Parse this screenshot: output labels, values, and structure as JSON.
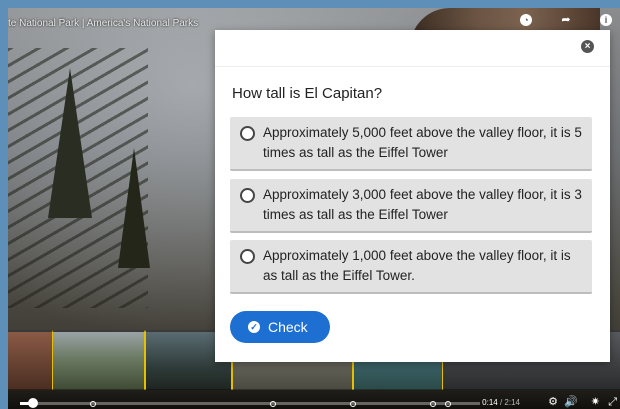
{
  "video": {
    "title_overlay": "te National Park | America's National Parks",
    "current_time": "0:14",
    "duration": "/ 2:14",
    "progress": 0.02
  },
  "top_icons": [
    "clock-icon",
    "share-icon",
    "info-icon"
  ],
  "modal": {
    "question": "How tall is El Capitan?",
    "options": [
      {
        "text": "Approximately 5,000 feet above the valley floor, it is 5 times as tall as the Eiffel Tower"
      },
      {
        "text": "Approximately 3,000 feet above the valley floor, it is 3 times as tall as the Eiffel Tower"
      },
      {
        "text": "Approximately 1,000 feet above the valley floor, it is as tall as the Eiffel Tower."
      }
    ],
    "check_label": "Check"
  },
  "controls": [
    "settings-cog-icon",
    "volume-icon",
    "gear-icon",
    "fullscreen-icon"
  ],
  "colors": {
    "accent": "#1d6fd1",
    "option_bg": "#e2e2e2",
    "page_bg": "#5d8fb8"
  }
}
